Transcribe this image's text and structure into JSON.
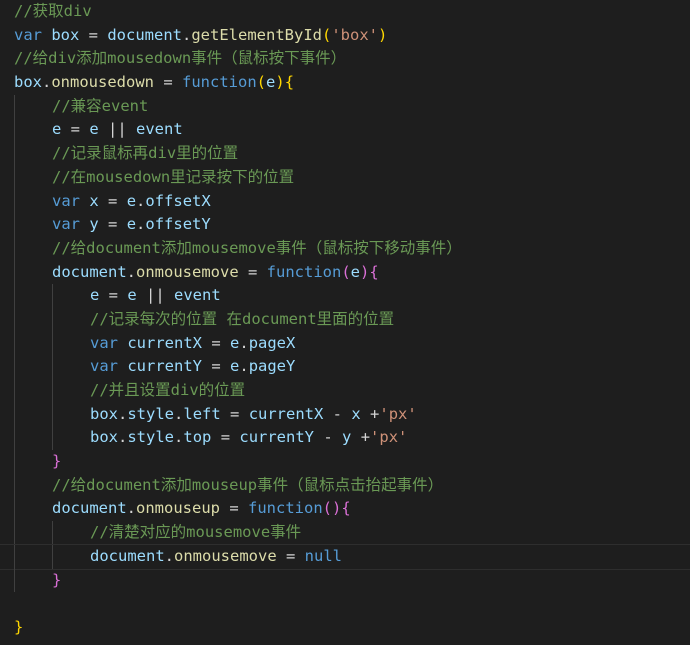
{
  "editor": {
    "lines": [
      {
        "indent": 0,
        "tokens": [
          {
            "t": "//获取div",
            "c": "comment"
          }
        ]
      },
      {
        "indent": 0,
        "tokens": [
          {
            "t": "var",
            "c": "keyword"
          },
          {
            "t": " ",
            "c": "op"
          },
          {
            "t": "box",
            "c": "var"
          },
          {
            "t": " = ",
            "c": "op"
          },
          {
            "t": "document",
            "c": "var"
          },
          {
            "t": ".",
            "c": "op"
          },
          {
            "t": "getElementById",
            "c": "fn"
          },
          {
            "t": "(",
            "c": "brace"
          },
          {
            "t": "'box'",
            "c": "string"
          },
          {
            "t": ")",
            "c": "brace"
          }
        ]
      },
      {
        "indent": 0,
        "tokens": [
          {
            "t": "//给div添加mousedown事件（鼠标按下事件）",
            "c": "comment"
          }
        ]
      },
      {
        "indent": 0,
        "tokens": [
          {
            "t": "box",
            "c": "var"
          },
          {
            "t": ".",
            "c": "op"
          },
          {
            "t": "onmousedown",
            "c": "fn"
          },
          {
            "t": " = ",
            "c": "op"
          },
          {
            "t": "function",
            "c": "keyword"
          },
          {
            "t": "(",
            "c": "brace"
          },
          {
            "t": "e",
            "c": "var"
          },
          {
            "t": ")",
            "c": "brace"
          },
          {
            "t": "{",
            "c": "brace"
          }
        ]
      },
      {
        "indent": 1,
        "tokens": [
          {
            "t": "//兼容event",
            "c": "comment"
          }
        ]
      },
      {
        "indent": 1,
        "tokens": [
          {
            "t": "e",
            "c": "var"
          },
          {
            "t": " = ",
            "c": "op"
          },
          {
            "t": "e",
            "c": "var"
          },
          {
            "t": " || ",
            "c": "op"
          },
          {
            "t": "event",
            "c": "var"
          }
        ]
      },
      {
        "indent": 1,
        "tokens": [
          {
            "t": "//记录鼠标再div里的位置",
            "c": "comment"
          }
        ]
      },
      {
        "indent": 1,
        "tokens": [
          {
            "t": "//在mousedown里记录按下的位置",
            "c": "comment"
          }
        ]
      },
      {
        "indent": 1,
        "tokens": [
          {
            "t": "var",
            "c": "keyword"
          },
          {
            "t": " ",
            "c": "op"
          },
          {
            "t": "x",
            "c": "var"
          },
          {
            "t": " = ",
            "c": "op"
          },
          {
            "t": "e",
            "c": "var"
          },
          {
            "t": ".",
            "c": "op"
          },
          {
            "t": "offsetX",
            "c": "var"
          }
        ]
      },
      {
        "indent": 1,
        "tokens": [
          {
            "t": "var",
            "c": "keyword"
          },
          {
            "t": " ",
            "c": "op"
          },
          {
            "t": "y",
            "c": "var"
          },
          {
            "t": " = ",
            "c": "op"
          },
          {
            "t": "e",
            "c": "var"
          },
          {
            "t": ".",
            "c": "op"
          },
          {
            "t": "offsetY",
            "c": "var"
          }
        ]
      },
      {
        "indent": 1,
        "tokens": [
          {
            "t": "//给document添加mousemove事件（鼠标按下移动事件）",
            "c": "comment"
          }
        ]
      },
      {
        "indent": 1,
        "tokens": [
          {
            "t": "document",
            "c": "var"
          },
          {
            "t": ".",
            "c": "op"
          },
          {
            "t": "onmousemove",
            "c": "fn"
          },
          {
            "t": " = ",
            "c": "op"
          },
          {
            "t": "function",
            "c": "keyword"
          },
          {
            "t": "(",
            "c": "paren"
          },
          {
            "t": "e",
            "c": "var"
          },
          {
            "t": ")",
            "c": "paren"
          },
          {
            "t": "{",
            "c": "paren"
          }
        ]
      },
      {
        "indent": 2,
        "tokens": [
          {
            "t": "e",
            "c": "var"
          },
          {
            "t": " = ",
            "c": "op"
          },
          {
            "t": "e",
            "c": "var"
          },
          {
            "t": " || ",
            "c": "op"
          },
          {
            "t": "event",
            "c": "var"
          }
        ]
      },
      {
        "indent": 2,
        "tokens": [
          {
            "t": "//记录每次的位置 在document里面的位置",
            "c": "comment"
          }
        ]
      },
      {
        "indent": 2,
        "tokens": [
          {
            "t": "var",
            "c": "keyword"
          },
          {
            "t": " ",
            "c": "op"
          },
          {
            "t": "currentX",
            "c": "var"
          },
          {
            "t": " = ",
            "c": "op"
          },
          {
            "t": "e",
            "c": "var"
          },
          {
            "t": ".",
            "c": "op"
          },
          {
            "t": "pageX",
            "c": "var"
          }
        ]
      },
      {
        "indent": 2,
        "tokens": [
          {
            "t": "var",
            "c": "keyword"
          },
          {
            "t": " ",
            "c": "op"
          },
          {
            "t": "currentY",
            "c": "var"
          },
          {
            "t": " = ",
            "c": "op"
          },
          {
            "t": "e",
            "c": "var"
          },
          {
            "t": ".",
            "c": "op"
          },
          {
            "t": "pageY",
            "c": "var"
          }
        ]
      },
      {
        "indent": 2,
        "tokens": [
          {
            "t": "//并且设置div的位置",
            "c": "comment"
          }
        ]
      },
      {
        "indent": 2,
        "tokens": [
          {
            "t": "box",
            "c": "var"
          },
          {
            "t": ".",
            "c": "op"
          },
          {
            "t": "style",
            "c": "var"
          },
          {
            "t": ".",
            "c": "op"
          },
          {
            "t": "left",
            "c": "var"
          },
          {
            "t": " = ",
            "c": "op"
          },
          {
            "t": "currentX",
            "c": "var"
          },
          {
            "t": " - ",
            "c": "op"
          },
          {
            "t": "x",
            "c": "var"
          },
          {
            "t": " +",
            "c": "op"
          },
          {
            "t": "'px'",
            "c": "string"
          }
        ]
      },
      {
        "indent": 2,
        "tokens": [
          {
            "t": "box",
            "c": "var"
          },
          {
            "t": ".",
            "c": "op"
          },
          {
            "t": "style",
            "c": "var"
          },
          {
            "t": ".",
            "c": "op"
          },
          {
            "t": "top",
            "c": "var"
          },
          {
            "t": " = ",
            "c": "op"
          },
          {
            "t": "currentY",
            "c": "var"
          },
          {
            "t": " - ",
            "c": "op"
          },
          {
            "t": "y",
            "c": "var"
          },
          {
            "t": " +",
            "c": "op"
          },
          {
            "t": "'px'",
            "c": "string"
          }
        ]
      },
      {
        "indent": 1,
        "tokens": [
          {
            "t": "}",
            "c": "paren"
          }
        ]
      },
      {
        "indent": 1,
        "tokens": [
          {
            "t": "//给document添加mouseup事件（鼠标点击抬起事件）",
            "c": "comment"
          }
        ]
      },
      {
        "indent": 1,
        "tokens": [
          {
            "t": "document",
            "c": "var"
          },
          {
            "t": ".",
            "c": "op"
          },
          {
            "t": "onmouseup",
            "c": "fn"
          },
          {
            "t": " = ",
            "c": "op"
          },
          {
            "t": "function",
            "c": "keyword"
          },
          {
            "t": "()",
            "c": "paren"
          },
          {
            "t": "{",
            "c": "paren"
          }
        ]
      },
      {
        "indent": 2,
        "tokens": [
          {
            "t": "//清楚对应的mousemove事件",
            "c": "comment"
          }
        ]
      },
      {
        "indent": 2,
        "current": true,
        "tokens": [
          {
            "t": "document",
            "c": "var"
          },
          {
            "t": ".",
            "c": "op"
          },
          {
            "t": "onmousemove",
            "c": "fn"
          },
          {
            "t": " = ",
            "c": "op"
          },
          {
            "t": "null",
            "c": "keyword"
          }
        ]
      },
      {
        "indent": 1,
        "tokens": [
          {
            "t": "}",
            "c": "paren"
          }
        ]
      },
      {
        "indent": 0,
        "tokens": []
      },
      {
        "indent": 0,
        "tokens": [
          {
            "t": "}",
            "c": "brace"
          }
        ]
      }
    ]
  }
}
